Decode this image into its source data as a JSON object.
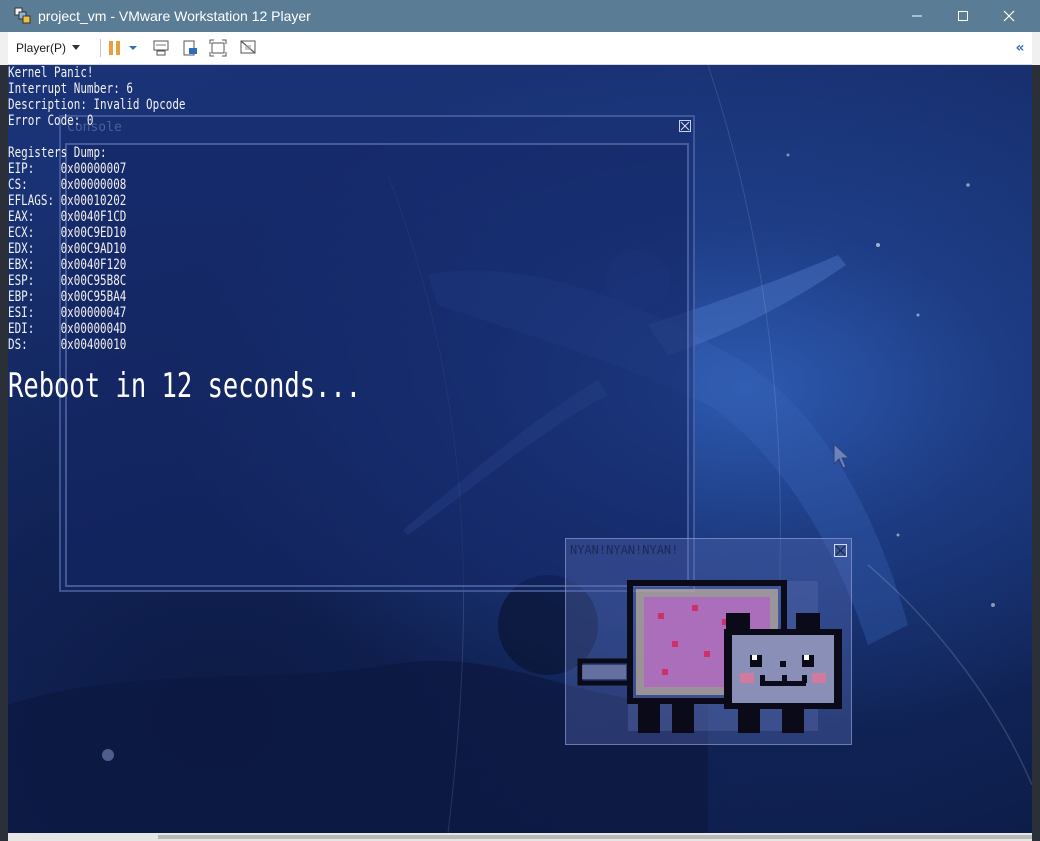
{
  "window": {
    "title": "project_vm - VMware Workstation 12 Player"
  },
  "toolbar": {
    "player_label": "Player(P)",
    "icons": [
      "pause-icon",
      "send-ctrl-alt-del-icon",
      "removable-devices-icon",
      "fullscreen-icon",
      "unity-icon",
      "collapse-icon"
    ]
  },
  "console_window": {
    "title": "Console"
  },
  "nyan_window": {
    "title": "NYAN!NYAN!NYAN!"
  },
  "panic": {
    "lines": [
      "Kernel Panic!",
      "Interrupt Number: 6",
      "Description: Invalid Opcode",
      "Error Code: 0",
      "",
      "Registers Dump:",
      "EIP:    0x00000007",
      "CS:     0x00000008",
      "EFLAGS: 0x00010202",
      "EAX:    0x0040F1CD",
      "ECX:    0x00C9ED10",
      "EDX:    0x00C9AD10",
      "EBX:    0x0040F120",
      "ESP:    0x00C95B8C",
      "EBP:    0x00C95BA4",
      "ESI:    0x00000047",
      "EDI:    0x0000004D",
      "DS:     0x00400010"
    ],
    "reboot": "Reboot in 12 seconds..."
  },
  "colors": {
    "titlebar": "#5a7d95",
    "screen_bg": "#17306f",
    "text": "#f2f2f2",
    "accent": "#e8a03a"
  }
}
